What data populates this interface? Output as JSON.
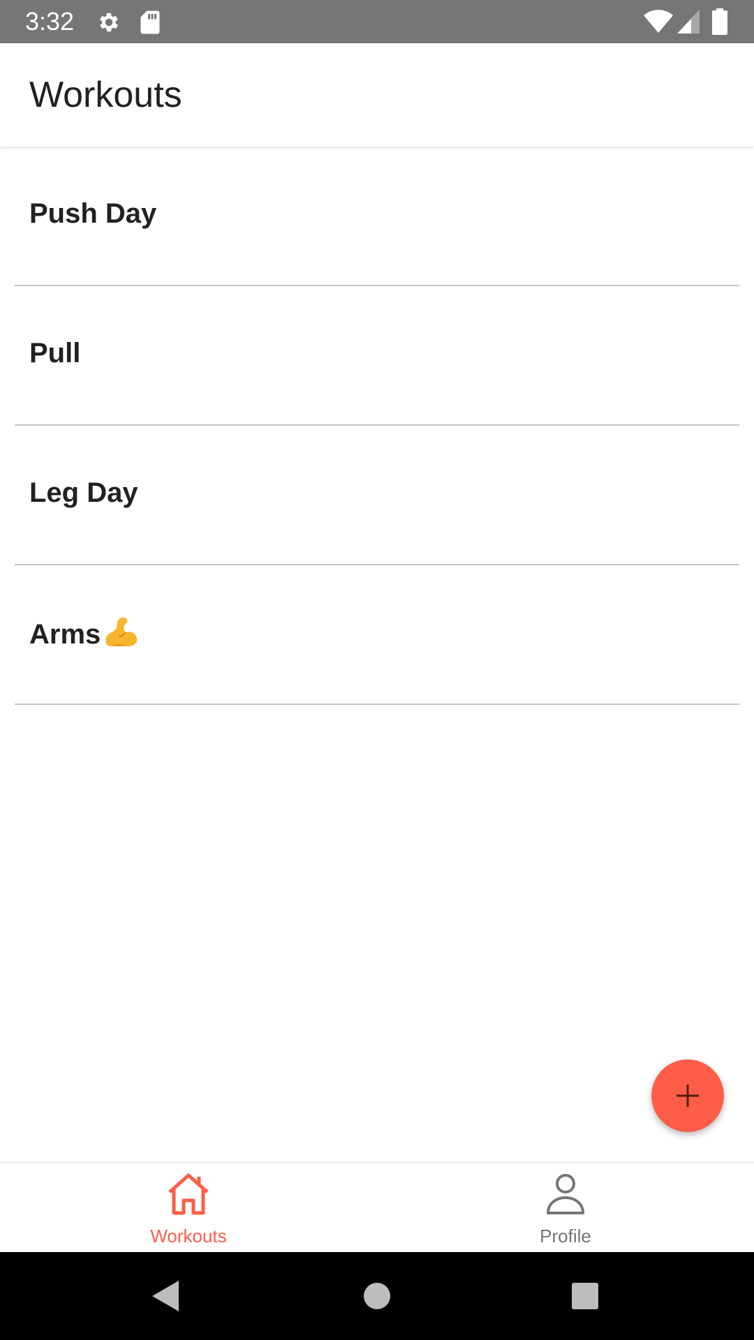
{
  "status_bar": {
    "time": "3:32",
    "icons": [
      "settings-gear-icon",
      "sd-card-icon",
      "wifi-icon",
      "cell-signal-icon",
      "battery-icon"
    ]
  },
  "app_bar": {
    "title": "Workouts"
  },
  "workouts": [
    {
      "label": "Push Day"
    },
    {
      "label": "Pull"
    },
    {
      "label": "Leg Day"
    },
    {
      "label": "Arms",
      "emoji": "flexed-biceps"
    }
  ],
  "fab": {
    "icon": "plus-icon",
    "color": "#fe5e48"
  },
  "bottom_nav": {
    "active_color": "#fe5e48",
    "inactive_color": "#757575",
    "tabs": [
      {
        "label": "Workouts",
        "icon": "home-icon",
        "active": true
      },
      {
        "label": "Profile",
        "icon": "person-icon",
        "active": false
      }
    ]
  },
  "system_nav": {
    "buttons": [
      "back-icon",
      "home-circle-icon",
      "recents-icon"
    ]
  }
}
